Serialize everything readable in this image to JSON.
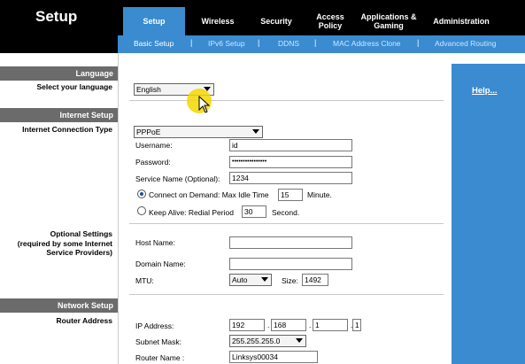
{
  "header": {
    "title": "Setup",
    "tabs": [
      {
        "label": "Setup",
        "active": true
      },
      {
        "label": "Wireless",
        "active": false
      },
      {
        "label": "Security",
        "active": false
      },
      {
        "label": "Access\nPolicy",
        "active": false
      },
      {
        "label": "Applications &\nGaming",
        "active": false
      },
      {
        "label": "Administration",
        "active": false
      }
    ],
    "subtabs": [
      {
        "label": "Basic Setup",
        "active": true
      },
      {
        "label": "IPv6 Setup",
        "active": false
      },
      {
        "label": "DDNS",
        "active": false
      },
      {
        "label": "MAC Address Clone",
        "active": false
      },
      {
        "label": "Advanced Routing",
        "active": false
      }
    ],
    "separator": "|"
  },
  "left": {
    "language_section": "Language",
    "select_language_label": "Select your language",
    "internet_section": "Internet Setup",
    "connection_type_label": "Internet Connection Type",
    "optional_settings_label": "Optional Settings\n(required by some Internet\nService Providers)",
    "network_section": "Network Setup",
    "router_address_label": "Router Address"
  },
  "language": {
    "value": "English"
  },
  "internet": {
    "connection_type": "PPPoE",
    "username_label": "Username:",
    "username_value": "id",
    "password_label": "Password:",
    "password_value": "••••••••••••••••",
    "service_name_label": "Service Name (Optional):",
    "service_name_value": "1234",
    "connect_on_demand_label": "Connect on Demand: Max Idle Time",
    "max_idle_time": "15",
    "minute_label": "Minute.",
    "keep_alive_label": "Keep Alive: Redial Period",
    "redial_period": "30",
    "second_label": "Second.",
    "connect_on_demand_selected": true
  },
  "optional": {
    "host_name_label": "Host Name:",
    "host_name_value": "",
    "domain_name_label": "Domain Name:",
    "domain_name_value": "",
    "mtu_label": "MTU:",
    "mtu_value": "Auto",
    "size_label": "Size:",
    "size_value": "1492"
  },
  "network": {
    "ip_label": "IP Address:",
    "ip": [
      "192",
      "168",
      "1",
      "1"
    ],
    "ip_sep": ".",
    "subnet_label": "Subnet Mask:",
    "subnet_value": "255.255.255.0",
    "router_name_label": "Router Name :",
    "router_name_value": "Linksys00034"
  },
  "help": {
    "link": "Help..."
  },
  "colors": {
    "blue": "#3a8bd0",
    "section_gray": "#6b6b6b",
    "cursor": "#f5d700"
  }
}
